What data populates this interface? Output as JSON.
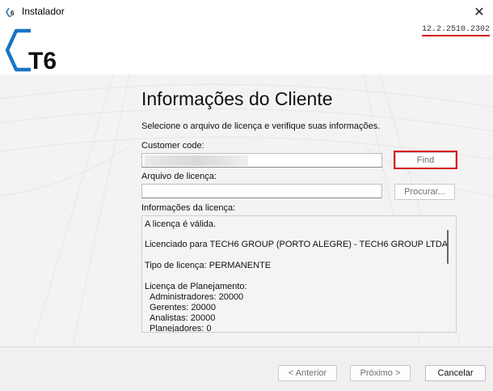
{
  "window": {
    "title": "Instalador",
    "close_glyph": "✕",
    "version": "12.2.2510.2302"
  },
  "logo": {
    "text": "T6"
  },
  "page": {
    "heading": "Informações do Cliente",
    "subtitle": "Selecione o arquivo de licença e verifique suas informações."
  },
  "form": {
    "customer_code_label": "Customer code:",
    "customer_code_value": "",
    "find_button": "Find",
    "license_file_label": "Arquivo de licença:",
    "license_file_value": "",
    "browse_button": "Procurar...",
    "license_info_label": "Informações da licença:"
  },
  "license_info": {
    "lines": [
      "A licença é válida.",
      "Licenciado para TECH6 GROUP (PORTO ALEGRE) - TECH6 GROUP LTDA",
      "Tipo de licença:  PERMANENTE",
      "Licença de Planejamento:",
      "Administradores: 20000",
      "Gerentes: 20000",
      "Analistas: 20000",
      "Planejadores: 0"
    ]
  },
  "footer": {
    "back_button": "< Anterior",
    "next_button": "Próximo >",
    "cancel_button": "Cancelar"
  },
  "colors": {
    "logo_blue": "#1a74c4",
    "highlight_red": "#d9141a"
  }
}
